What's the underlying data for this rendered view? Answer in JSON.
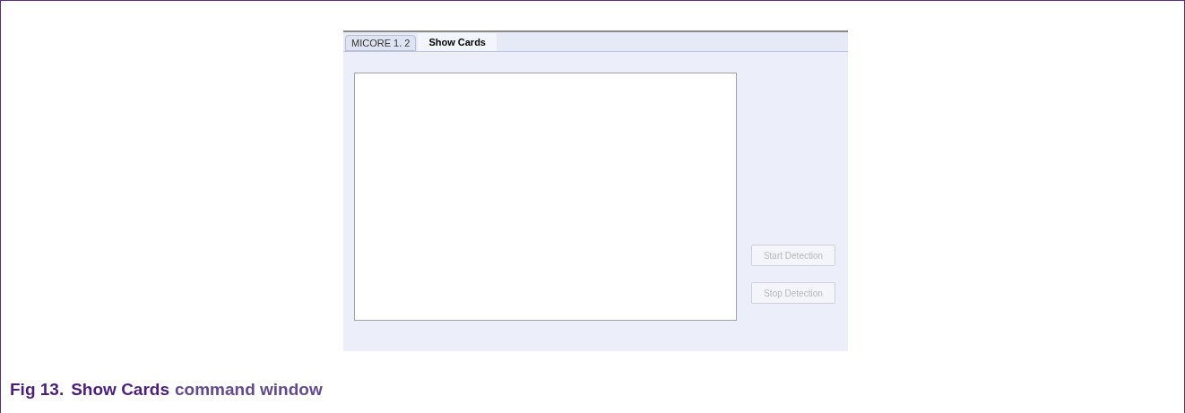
{
  "tabs": [
    {
      "label": "MICORE 1. 2",
      "selected": false
    },
    {
      "label": "Show Cards",
      "selected": true
    }
  ],
  "buttons": [
    {
      "label": "Start Detection",
      "disabled": true
    },
    {
      "label": "Stop Detection",
      "disabled": true
    }
  ],
  "caption": {
    "number": "Fig 13.",
    "title_emphasis": "Show Cards",
    "title_rest": "command window"
  }
}
